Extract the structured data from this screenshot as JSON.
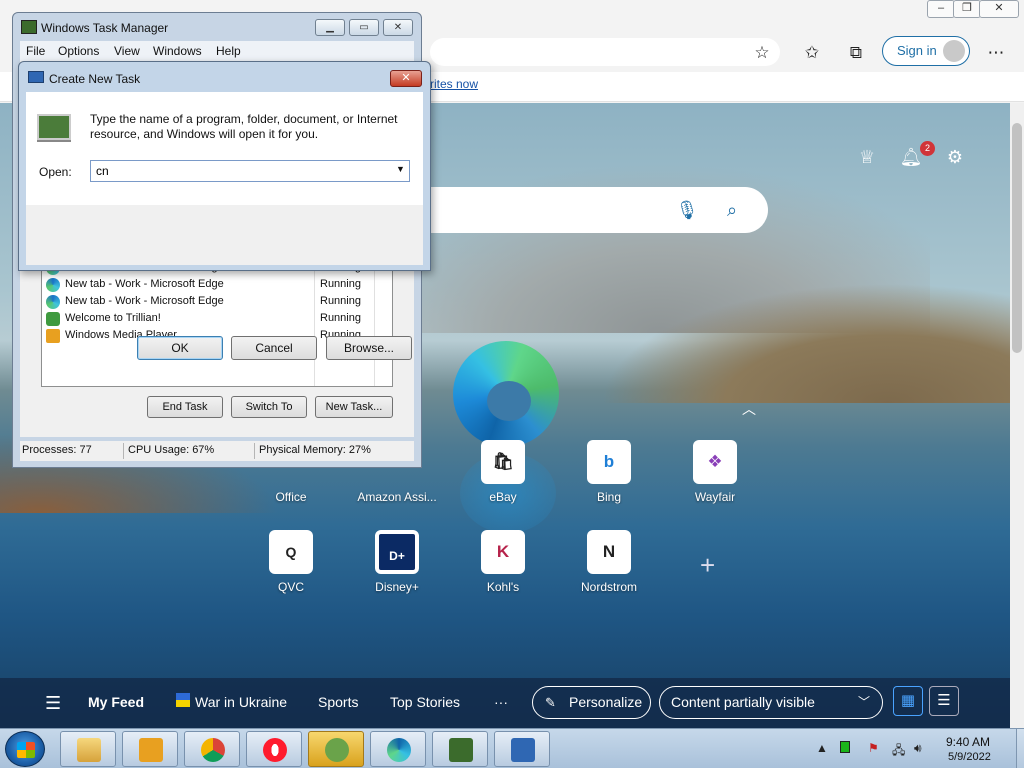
{
  "taskmanager": {
    "title": "Windows Task Manager",
    "menu": [
      "File",
      "Options",
      "View",
      "Windows",
      "Help"
    ],
    "processes": [
      {
        "name": "New tab - Work - Microsoft Edge",
        "status": "Running",
        "icon": "edge-icon"
      },
      {
        "name": "New tab - Work - Microsoft Edge",
        "status": "Running",
        "icon": "edge-icon"
      },
      {
        "name": "New tab - Work - Microsoft Edge",
        "status": "Running",
        "icon": "edge-icon"
      },
      {
        "name": "Welcome to Trillian!",
        "status": "Running",
        "icon": "trillian-icon"
      },
      {
        "name": "Windows Media Player",
        "status": "Running",
        "icon": "media-player-icon"
      }
    ],
    "buttons": {
      "end_task": "End Task",
      "switch_to": "Switch To",
      "new_task": "New Task..."
    },
    "status": {
      "processes": "Processes: 77",
      "cpu": "CPU Usage: 67%",
      "memory": "Physical Memory: 27%"
    }
  },
  "dialog": {
    "title": "Create New Task",
    "description": "Type the name of a program, folder, document, or Internet resource, and Windows will open it for you.",
    "open_label": "Open:",
    "open_value": "cn",
    "ok": "OK",
    "cancel": "Cancel",
    "browse": "Browse..."
  },
  "edge": {
    "signin": "Sign in",
    "favorites_link": "rites now",
    "notification_count": "2",
    "tiles": [
      {
        "label": "Office",
        "glyph": ""
      },
      {
        "label": "Amazon Assi...",
        "glyph": ""
      },
      {
        "label": "eBay",
        "glyph": "🛍"
      },
      {
        "label": "Bing",
        "glyph": "b"
      },
      {
        "label": "Wayfair",
        "glyph": "❖"
      },
      {
        "label": "QVC",
        "glyph": "Q"
      },
      {
        "label": "Disney+",
        "glyph": "D+"
      },
      {
        "label": "Kohl's",
        "glyph": "K"
      },
      {
        "label": "Nordstrom",
        "glyph": "N"
      }
    ],
    "feed": {
      "my_feed": "My Feed",
      "war": "War in Ukraine",
      "sports": "Sports",
      "top_stories": "Top Stories",
      "more": "···",
      "personalize": "Personalize",
      "content_select": "Content partially visible"
    }
  },
  "taskbar": {
    "time": "9:40 AM",
    "date": "5/9/2022",
    "apps": [
      "explorer-icon",
      "media-player-icon",
      "chrome-icon",
      "opera-icon",
      "trillian-icon",
      "edge-icon",
      "task-manager-icon",
      "run-dialog-icon"
    ]
  }
}
